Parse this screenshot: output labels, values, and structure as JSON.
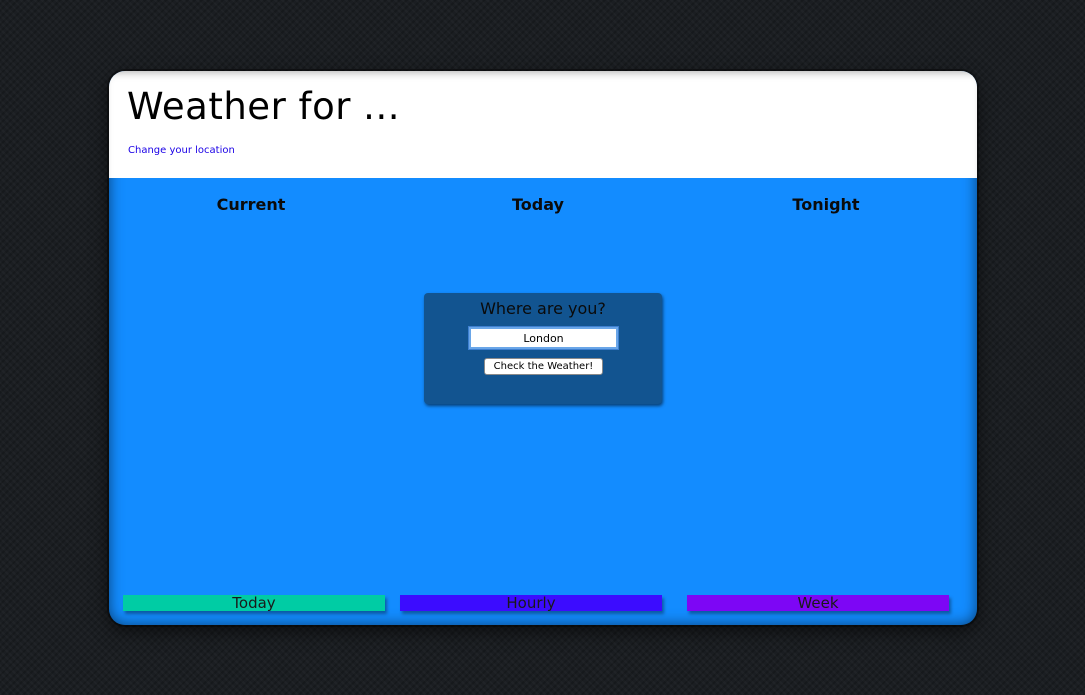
{
  "header": {
    "title": "Weather for ...",
    "change_location_link": "Change your location"
  },
  "columns": [
    {
      "label": "Current"
    },
    {
      "label": "Today"
    },
    {
      "label": "Tonight"
    }
  ],
  "location_form": {
    "prompt": "Where are you?",
    "input_value": "London",
    "button_label": "Check the Weather!"
  },
  "tabs": [
    {
      "label": "Today",
      "color": "#00cca4"
    },
    {
      "label": "Hourly",
      "color": "#3c0cff"
    },
    {
      "label": "Week",
      "color": "#7d06f5"
    }
  ],
  "colors": {
    "page_background": "#1b1e22",
    "main_panel": "#138cff",
    "location_box": "#125490",
    "link": "#1a00e6"
  }
}
